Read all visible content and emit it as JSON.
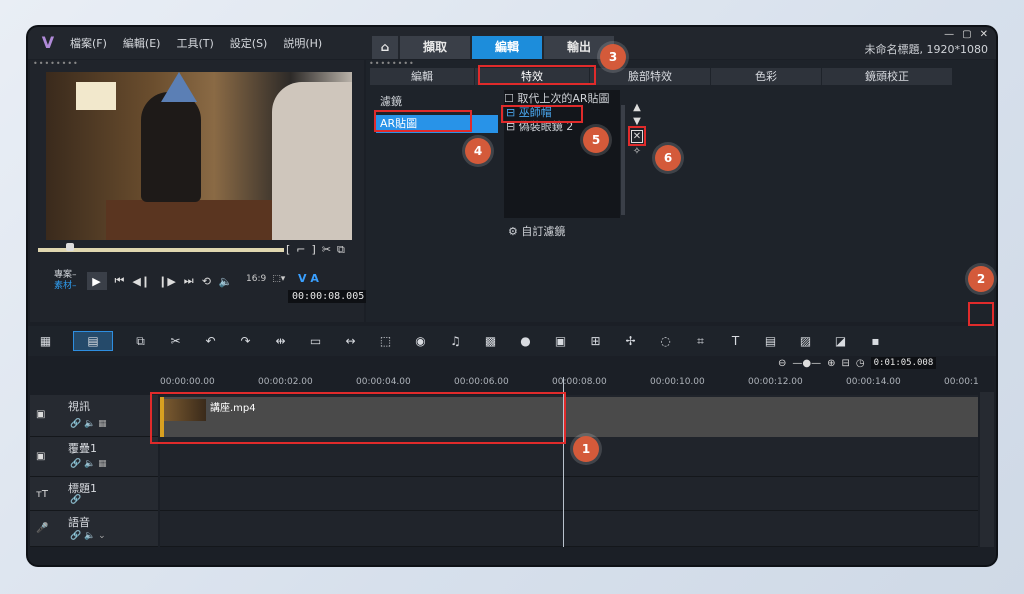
{
  "app": {
    "logo": "V",
    "title": "未命名標題, 1920*1080",
    "win_buttons": [
      "—",
      "▢",
      "✕"
    ]
  },
  "menu": [
    "檔案(F)",
    "編輯(E)",
    "工具(T)",
    "設定(S)",
    "説明(H)"
  ],
  "main_tabs": [
    {
      "label": "⌂"
    },
    {
      "label": "擷取"
    },
    {
      "label": "編輯"
    },
    {
      "label": "輸出"
    }
  ],
  "preview": {
    "project_label": "專案–",
    "clip_label": "素材–",
    "timecode": "00:00:08.005",
    "aspect": "16:9",
    "va": "V A"
  },
  "fx": {
    "subtabs": [
      "編輯",
      "特效",
      "臉部特效",
      "色彩",
      "鏡頭校正"
    ],
    "categories": [
      "濾鏡",
      "AR貼圖"
    ],
    "replace_checkbox": "取代上次的AR貼圖",
    "ar_items": [
      "巫師帽",
      "偽裝眼鏡 2"
    ],
    "custom_filter": "自訂濾鏡"
  },
  "timeline": {
    "zoom_timecode": "0:01:05.008",
    "ruler": [
      "00:00:00.00",
      "00:00:02.00",
      "00:00:04.00",
      "00:00:06.00",
      "00:00:08.00",
      "00:00:10.00",
      "00:00:12.00",
      "00:00:14.00",
      "00:00:1"
    ],
    "tracks": [
      {
        "name": "視訊"
      },
      {
        "name": "覆疊1"
      },
      {
        "name": "標題1"
      },
      {
        "name": "語音"
      }
    ],
    "clip_name": "講座.mp4"
  },
  "annotations": [
    "1",
    "2",
    "3",
    "4",
    "5",
    "6"
  ]
}
